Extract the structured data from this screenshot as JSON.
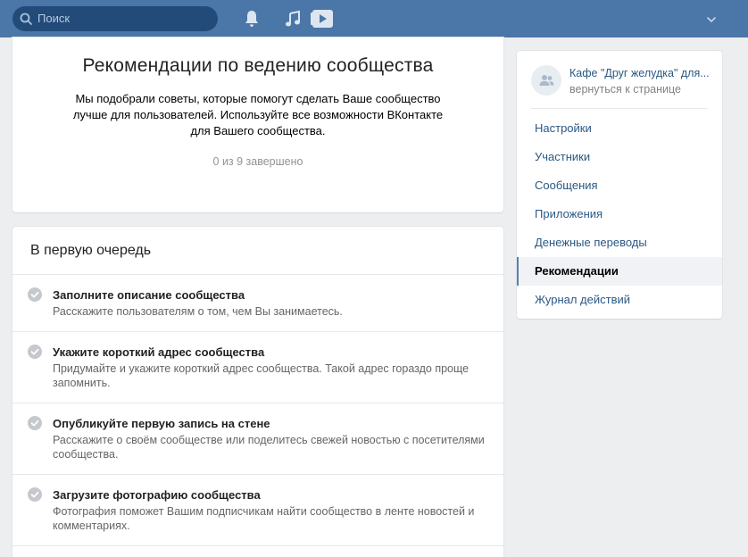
{
  "topbar": {
    "search_placeholder": "Поиск",
    "icons": [
      "search-icon",
      "bell-icon",
      "music-icon",
      "video-icon",
      "chevron-down-icon"
    ],
    "colors": {
      "bar": "#4a76a8",
      "search_bg": "#224b7a"
    }
  },
  "hero": {
    "title": "Рекомендации по ведению сообщества",
    "description": "Мы подобрали советы, которые помогут сделать Ваше сообщество лучше для пользователей. Используйте все возможности ВКонтакте для Вашего сообщества.",
    "progress": "0 из 9 завершено"
  },
  "list": {
    "header": "В первую очередь",
    "tasks": [
      {
        "title": "Заполните описание сообщества",
        "subtitle": "Расскажите пользователям о том, чем Вы занимаетесь."
      },
      {
        "title": "Укажите короткий адрес сообщества",
        "subtitle": "Придумайте и укажите короткий адрес сообщества. Такой адрес гораздо проще запомнить."
      },
      {
        "title": "Опубликуйте первую запись на стене",
        "subtitle": "Расскажите о своём сообществе или поделитесь свежей новостью с посетителями сообщества."
      },
      {
        "title": "Загрузите фотографию сообщества",
        "subtitle": "Фотография поможет Вашим подписчикам найти сообщество в ленте новостей и комментариях."
      }
    ]
  },
  "sidebar": {
    "group_name": "Кафе \"Друг желудка\" для...",
    "back_link": "вернуться к странице",
    "items": [
      {
        "label": "Настройки",
        "active": false
      },
      {
        "label": "Участники",
        "active": false
      },
      {
        "label": "Сообщения",
        "active": false
      },
      {
        "label": "Приложения",
        "active": false
      },
      {
        "label": "Денежные переводы",
        "active": false
      },
      {
        "label": "Рекомендации",
        "active": true
      },
      {
        "label": "Журнал действий",
        "active": false
      }
    ],
    "colors": {
      "link": "#2a5885",
      "active_border": "#5181b8"
    }
  }
}
